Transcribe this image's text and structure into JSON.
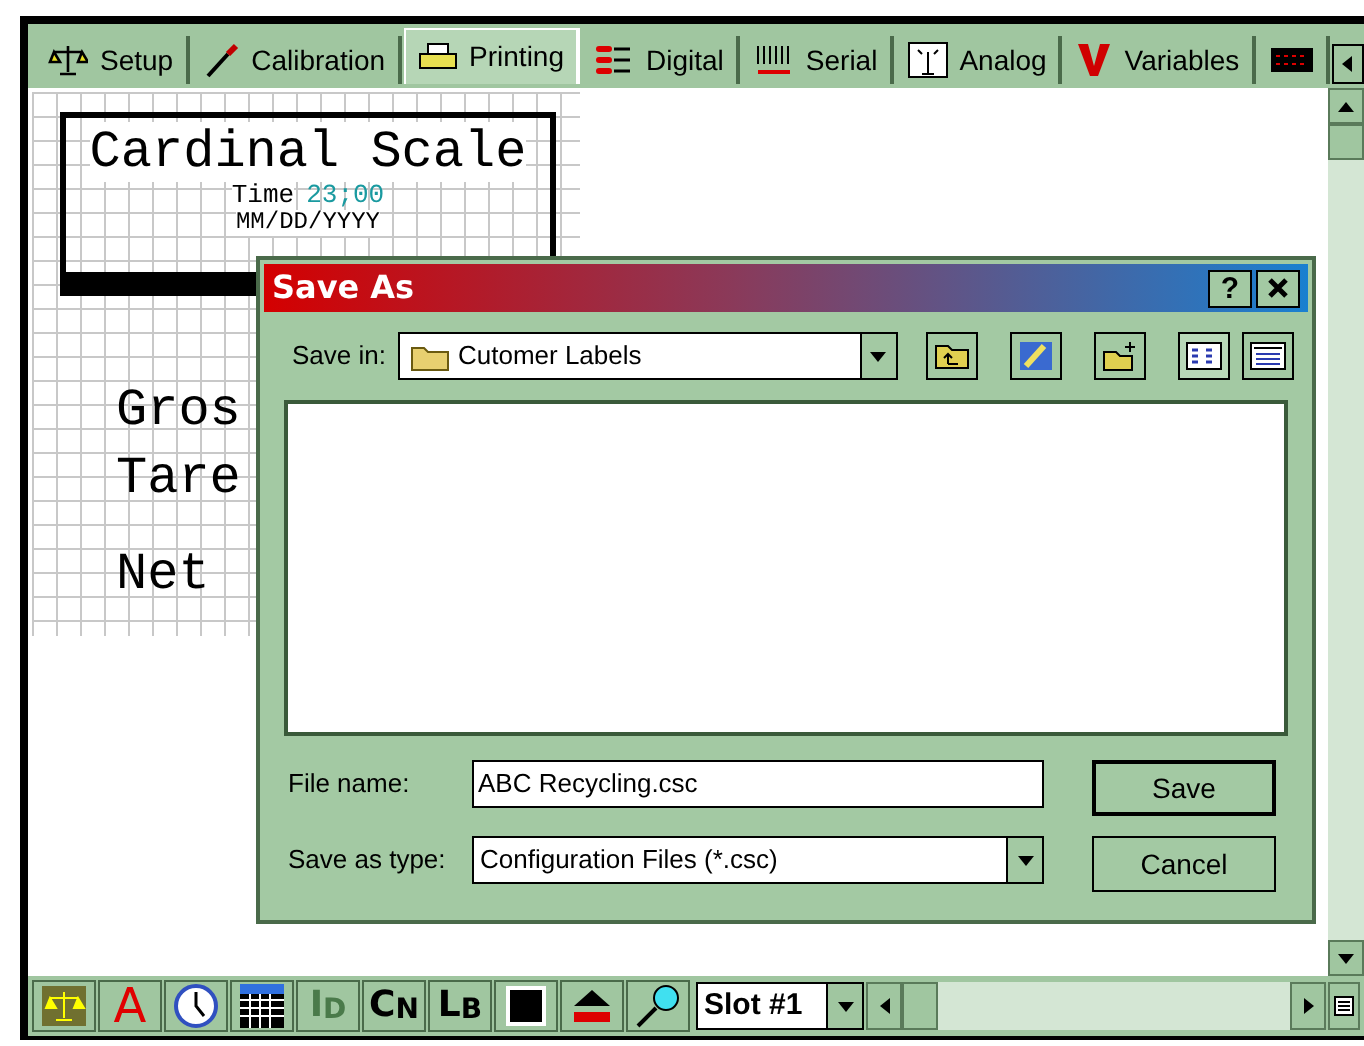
{
  "tabs": [
    {
      "label": "Setup",
      "kind": "scale",
      "selected": false
    },
    {
      "label": "Calibration",
      "kind": "screwdriver",
      "selected": false
    },
    {
      "label": "Printing",
      "kind": "printer",
      "selected": true
    },
    {
      "label": "Digital",
      "kind": "bars",
      "selected": false
    },
    {
      "label": "Serial",
      "kind": "serial",
      "selected": false
    },
    {
      "label": "Analog",
      "kind": "antenna",
      "selected": false
    },
    {
      "label": "Variables",
      "kind": "v",
      "selected": false
    },
    {
      "kind": "display",
      "selected": false
    }
  ],
  "label_design": {
    "title": "Cardinal Scale",
    "time_label": "Time",
    "time_value": "23;00",
    "date_format": "MM/DD/YYYY",
    "fields": [
      "Gros",
      "Tare",
      "Net"
    ]
  },
  "dialog": {
    "title": "Save As",
    "help": "?",
    "save_in_label": "Save in:",
    "save_in_value": "Cutomer Labels",
    "file_name_label": "File name:",
    "file_name": "ABC Recycling.csc",
    "type_label": "Save as type:",
    "type_value": "Configuration Files (*.csc)",
    "buttons": [
      "Save",
      "Cancel"
    ]
  },
  "toolbar": [
    {
      "kind": "scale",
      "disabled": false
    },
    {
      "kind": "text",
      "label": "A",
      "disabled": false
    },
    {
      "kind": "clock",
      "disabled": false
    },
    {
      "kind": "grid",
      "disabled": false
    },
    {
      "kind": "pair",
      "label": "I",
      "sub": "D",
      "disabled": true
    },
    {
      "kind": "pair",
      "label": "C",
      "sub": "N",
      "disabled": false
    },
    {
      "kind": "pair",
      "label": "L",
      "sub": "B",
      "disabled": false
    },
    {
      "kind": "square",
      "disabled": false
    },
    {
      "kind": "eject",
      "disabled": false
    },
    {
      "kind": "magnifier",
      "disabled": false
    }
  ],
  "slot": "Slot #1"
}
